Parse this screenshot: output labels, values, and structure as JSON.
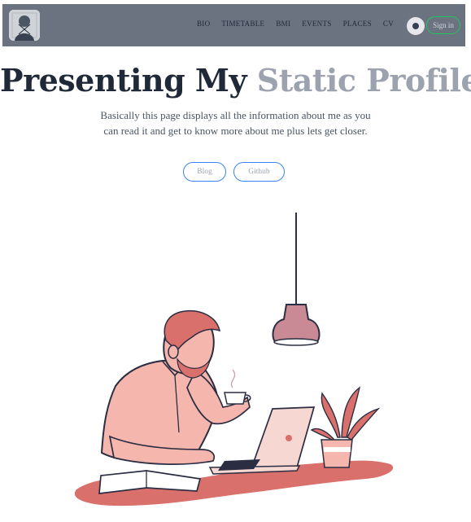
{
  "header": {
    "nav": [
      "BIO",
      "TIMETABLE",
      "BMI",
      "EVENTS",
      "PLACES",
      "CV"
    ],
    "signin_label": "Sign in"
  },
  "hero": {
    "title_dark": "Presenting My",
    "title_light": "Static Profile",
    "subtitle": "Basically this page displays all the information about me as you can read it and get to know more about me plus lets get closer.",
    "buttons": [
      "Blog",
      "Github"
    ]
  },
  "colors": {
    "topbar": "#6b7280",
    "accent_button_border": "#3b82f6",
    "signin_border": "#22c55e",
    "illustration_pink": "#f4b6ad",
    "illustration_red": "#d9706b"
  },
  "icons": [
    "avatar",
    "theme-toggle-icon"
  ]
}
